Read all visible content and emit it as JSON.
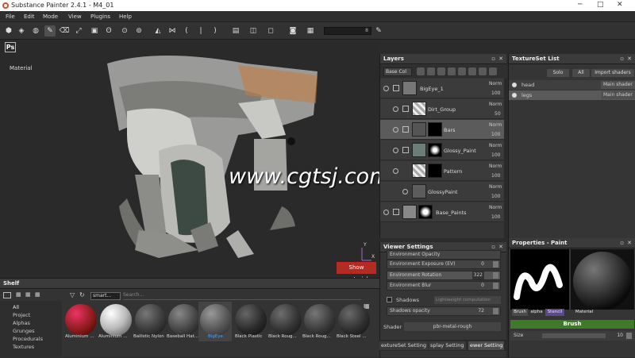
{
  "window": {
    "title": "Substance Painter 2.4.1 - M4_01",
    "minimize": "─",
    "maximize": "□",
    "close": "✕"
  },
  "menu": [
    "File",
    "Edit",
    "Mode",
    "View",
    "Plugins",
    "Help"
  ],
  "toolbar": {
    "slider_value": "8"
  },
  "viewport": {
    "ps_label": "Ps",
    "channel_label": "Material",
    "watermark": "www.cgtsj.com",
    "show_material_button": "Show material",
    "axis_x": "X",
    "axis_y": "Y"
  },
  "layers": {
    "title": "Layers",
    "blend_mode": "Base Col",
    "rows": [
      {
        "name": "BigEye_1",
        "blend": "Norm",
        "opacity": "100"
      },
      {
        "name": "Dirt_Group",
        "blend": "Norm",
        "opacity": "50"
      },
      {
        "name": "Bars",
        "blend": "Norm",
        "opacity": "100"
      },
      {
        "name": "Glossy_Paint",
        "blend": "Norm",
        "opacity": "100"
      },
      {
        "name": "Pattern",
        "blend": "Norm",
        "opacity": "100"
      },
      {
        "name": "GlossyPaint",
        "blend": "Norm",
        "opacity": "100"
      },
      {
        "name": "Base_Paints",
        "blend": "Norm",
        "opacity": "100"
      }
    ]
  },
  "textureset_list": {
    "title": "TextureSet List",
    "solo": "Solo",
    "all": "All",
    "import_shaders": "Import shaders",
    "sets": [
      {
        "name": "head",
        "shader": "Main shader"
      },
      {
        "name": "legs",
        "shader": "Main shader"
      }
    ]
  },
  "viewer_settings": {
    "title": "Viewer Settings",
    "rows": [
      {
        "label": "Environment Opacity",
        "value": ""
      },
      {
        "label": "Environment Exposure (EV)",
        "value": "0"
      },
      {
        "label": "Environment Rotation",
        "value": "322"
      },
      {
        "label": "Environment Blur",
        "value": "0"
      }
    ],
    "shadows_label": "Shadows",
    "shadows_mode": "Lightweight computation",
    "shadows_opacity_label": "Shadows opacity",
    "shadows_opacity_value": "72",
    "shader_label": "Shader",
    "shader_value": "pbr-metal-rough"
  },
  "dock_tabs": [
    "extureSet Setting",
    "splay Setting",
    "ewer Setting"
  ],
  "properties": {
    "title": "Properties - Paint",
    "tabs": [
      "Brush",
      "alpha",
      "Stencil",
      "Material"
    ],
    "brush_header": "Brush",
    "size_label": "Size",
    "size_value": "10"
  },
  "shelf": {
    "title": "Shelf",
    "categories": [
      "All",
      "Project",
      "Alphas",
      "Grunges",
      "Procedurals",
      "Textures"
    ],
    "filter_tag": "smart...",
    "search_placeholder": "Search...",
    "materials": [
      {
        "name": "Aluminium ...",
        "color": "#8b1c1c"
      },
      {
        "name": "Aluminium ...",
        "color": "#b9b9b9"
      },
      {
        "name": "Ballistic Nylon",
        "color": "#3a3a3a"
      },
      {
        "name": "Baseball Hat...",
        "color": "#444444"
      },
      {
        "name": "BigEye",
        "color": "#555555"
      },
      {
        "name": "Black Plastic",
        "color": "#2a2a2a"
      },
      {
        "name": "Black Roug...",
        "color": "#333333"
      },
      {
        "name": "Black Roug...",
        "color": "#3a3a3a"
      },
      {
        "name": "Black Steel ...",
        "color": "#2f2f2f"
      }
    ]
  },
  "colors": {
    "accent_red": "#b42b23",
    "brush_green": "#3e7a2a",
    "selected_material_label": "#4aa3ff"
  }
}
